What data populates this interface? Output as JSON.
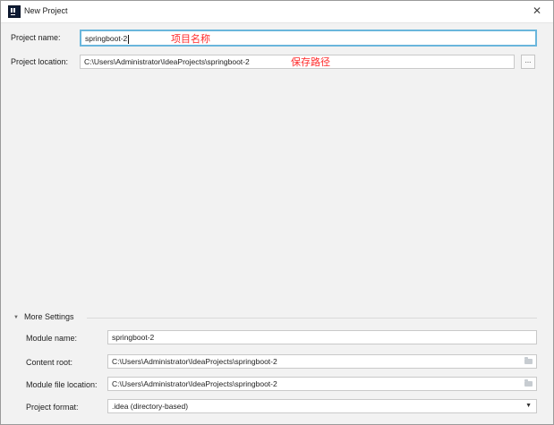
{
  "window": {
    "title": "New Project",
    "close_symbol": "✕"
  },
  "project_name": {
    "label": "Project name:",
    "value": "springboot-2",
    "annotation": "项目名称"
  },
  "project_location": {
    "label": "Project location:",
    "value": "C:\\Users\\Administrator\\IdeaProjects\\springboot-2",
    "annotation": "保存路径",
    "browse_label": "..."
  },
  "more_settings": {
    "header": "More Settings",
    "module_name": {
      "label": "Module name:",
      "value": "springboot-2"
    },
    "content_root": {
      "label": "Content root:",
      "value": "C:\\Users\\Administrator\\IdeaProjects\\springboot-2"
    },
    "module_file_location": {
      "label": "Module file location:",
      "value": "C:\\Users\\Administrator\\IdeaProjects\\springboot-2"
    },
    "project_format": {
      "label": "Project format:",
      "value": ".idea (directory-based)"
    }
  },
  "colors": {
    "annotation": "#ff2b2b",
    "focus_border": "#6ab6dc",
    "background": "#f2f2f2"
  }
}
